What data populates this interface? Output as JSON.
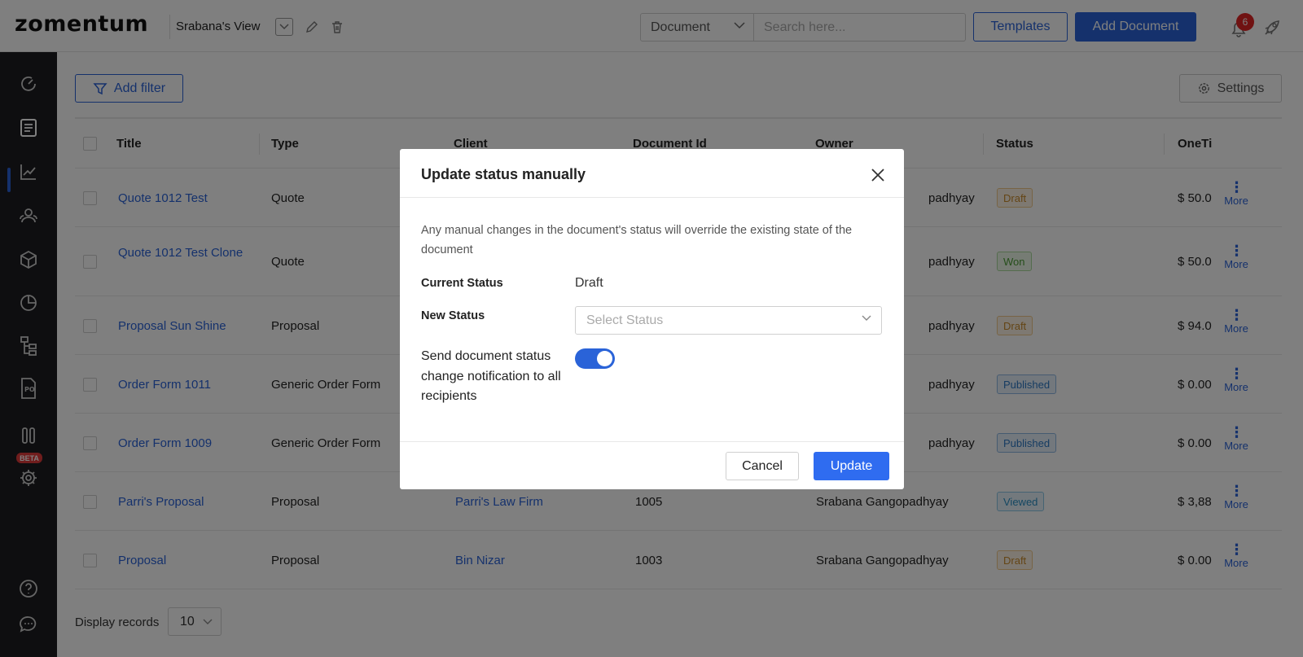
{
  "app": {
    "logo": "zomentum",
    "view_name": "Srabana's View"
  },
  "topbar": {
    "doc_type": "Document",
    "search_placeholder": "Search here...",
    "templates_label": "Templates",
    "add_document_label": "Add Document",
    "notification_count": "6"
  },
  "sidebar": {
    "beta_label": "BETA"
  },
  "toolbar": {
    "add_filter_label": "Add filter",
    "settings_label": "Settings"
  },
  "table": {
    "headers": [
      "Title",
      "Type",
      "Client",
      "Document Id",
      "Owner",
      "Status",
      "OneTi"
    ],
    "more_label": "More",
    "rows": [
      {
        "title": "Quote 1012 Test",
        "type": "Quote",
        "client": "",
        "doc_id": "",
        "owner": "padhyay",
        "status": "Draft",
        "amount": "$ 50.0"
      },
      {
        "title": "Quote 1012 Test Clone",
        "type": "Quote",
        "client": "",
        "doc_id": "",
        "owner": "padhyay",
        "status": "Won",
        "amount": "$ 50.0"
      },
      {
        "title": "Proposal Sun Shine",
        "type": "Proposal",
        "client": "",
        "doc_id": "",
        "owner": "padhyay",
        "status": "Draft",
        "amount": "$ 94.0"
      },
      {
        "title": "Order Form 1011",
        "type": "Generic Order Form",
        "client": "",
        "doc_id": "",
        "owner": "padhyay",
        "status": "Published",
        "amount": "$ 0.00"
      },
      {
        "title": "Order Form 1009",
        "type": "Generic Order Form",
        "client": "",
        "doc_id": "",
        "owner": "padhyay",
        "status": "Published",
        "amount": "$ 0.00"
      },
      {
        "title": "Parri's Proposal",
        "type": "Proposal",
        "client": "Parri's Law Firm",
        "doc_id": "1005",
        "owner": "Srabana Gangopadhyay",
        "status": "Viewed",
        "amount": "$ 3,88"
      },
      {
        "title": "Proposal",
        "type": "Proposal",
        "client": "Bin Nizar",
        "doc_id": "1003",
        "owner": "Srabana Gangopadhyay",
        "status": "Draft",
        "amount": "$ 0.00"
      }
    ]
  },
  "footer": {
    "display_records_label": "Display records",
    "records_value": "10"
  },
  "modal": {
    "title": "Update status manually",
    "description": "Any manual changes in the document's status will override the existing state of the document",
    "current_status_label": "Current Status",
    "current_status_value": "Draft",
    "new_status_label": "New Status",
    "new_status_placeholder": "Select Status",
    "notify_label": "Send document status change notification to all recipients",
    "notify_on": true,
    "cancel_label": "Cancel",
    "update_label": "Update"
  }
}
